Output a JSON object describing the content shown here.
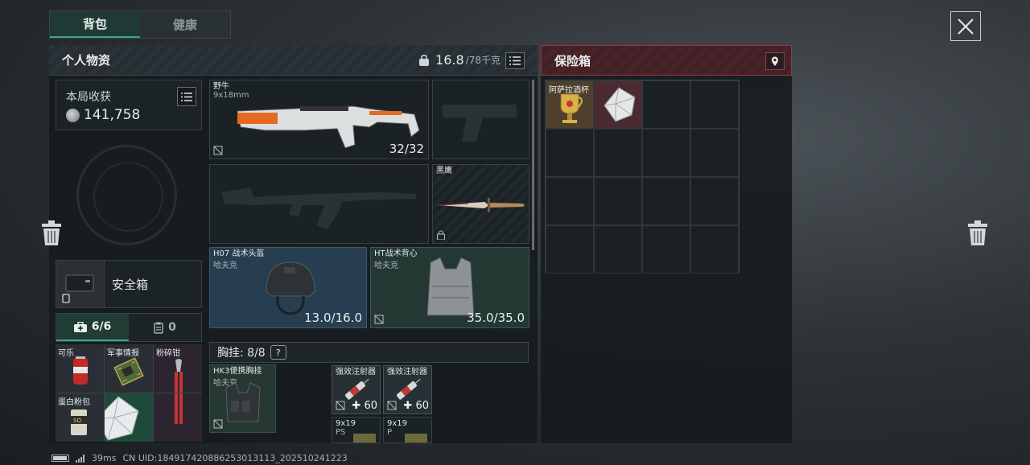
{
  "tabs": [
    {
      "label": "背包",
      "active": true
    },
    {
      "label": "健康",
      "active": false
    }
  ],
  "personal": {
    "title": "个人物资",
    "weight_current": "16.8",
    "weight_max": "/78千克"
  },
  "harvest": {
    "title": "本局收获",
    "value": "141,758"
  },
  "secure_container": {
    "label": "安全箱"
  },
  "mini_tabs": [
    {
      "label": "6/6",
      "icon": "medkit-icon",
      "active": true
    },
    {
      "label": "0",
      "icon": "clipboard-icon",
      "active": false
    }
  ],
  "pocket": [
    {
      "label": "可乐",
      "icon": "cola-can-icon"
    },
    {
      "label": "军事情报",
      "icon": "intel-chip-icon"
    },
    {
      "label": "粉碎钳",
      "icon": "pliers-icon"
    },
    {
      "label": "蛋白粉包",
      "icon": "protein-powder-icon"
    },
    {
      "label": "",
      "icon": "diamond-icon"
    },
    {
      "label": "",
      "icon": "pliers-handle-icon"
    }
  ],
  "weapons": {
    "primary": {
      "name": "野牛",
      "ammo_type": "9x18mm",
      "ammo": "32/32"
    },
    "knife": {
      "name": "黑鹰"
    }
  },
  "armor": {
    "helmet": {
      "name": "H07 战术头盔",
      "brand": "哈夫克",
      "durability": "13.0/16.0"
    },
    "vest": {
      "name": "HT战术背心",
      "brand": "哈夫克",
      "durability": "35.0/35.0"
    }
  },
  "chest_rig": {
    "header": "胸挂: 8/8",
    "help": "?",
    "rig": {
      "name": "HK3便携胸挂",
      "brand": "哈夫克"
    },
    "items": [
      {
        "name": "强效注射器",
        "value": "60"
      },
      {
        "name": "强效注射器",
        "value": "60"
      },
      {
        "name": "9x19",
        "sub": "PS"
      },
      {
        "name": "9x19",
        "sub": "P"
      }
    ]
  },
  "safe_box": {
    "title": "保险箱",
    "items": [
      {
        "label": "阿萨拉酒杯",
        "icon": "goblet-icon"
      },
      {
        "label": "",
        "icon": "diamond-icon"
      }
    ]
  },
  "status": {
    "ping": "39ms",
    "uid": "CN UID:1849174208862530131​13_202510241223"
  },
  "colors": {
    "accent": "#3fa38a",
    "safe_box_accent": "#8f3a40"
  }
}
